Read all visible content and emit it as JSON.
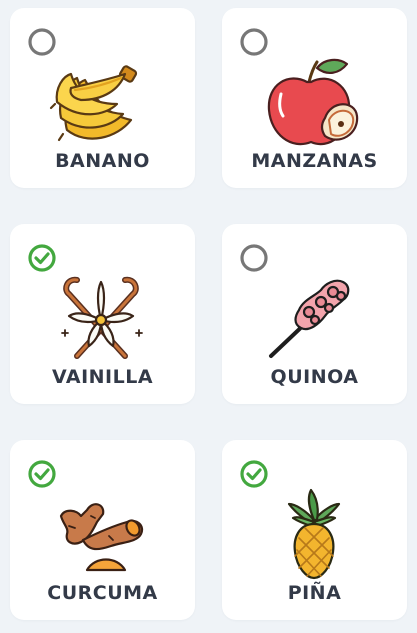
{
  "colors": {
    "background": "#eff3f7",
    "card": "#ffffff",
    "label": "#333a48",
    "check_selected": "#43a83f",
    "check_unselected": "#777777"
  },
  "items": [
    {
      "label": "BANANO",
      "selected": false,
      "icon": "bananas-icon"
    },
    {
      "label": "MANZANAS",
      "selected": false,
      "icon": "apple-icon"
    },
    {
      "label": "VAINILLA",
      "selected": true,
      "icon": "vanilla-flower-icon"
    },
    {
      "label": "QUINOA",
      "selected": false,
      "icon": "quinoa-stalk-icon"
    },
    {
      "label": "CURCUMA",
      "selected": true,
      "icon": "turmeric-root-icon"
    },
    {
      "label": "PIÑA",
      "selected": true,
      "icon": "pineapple-icon"
    }
  ]
}
